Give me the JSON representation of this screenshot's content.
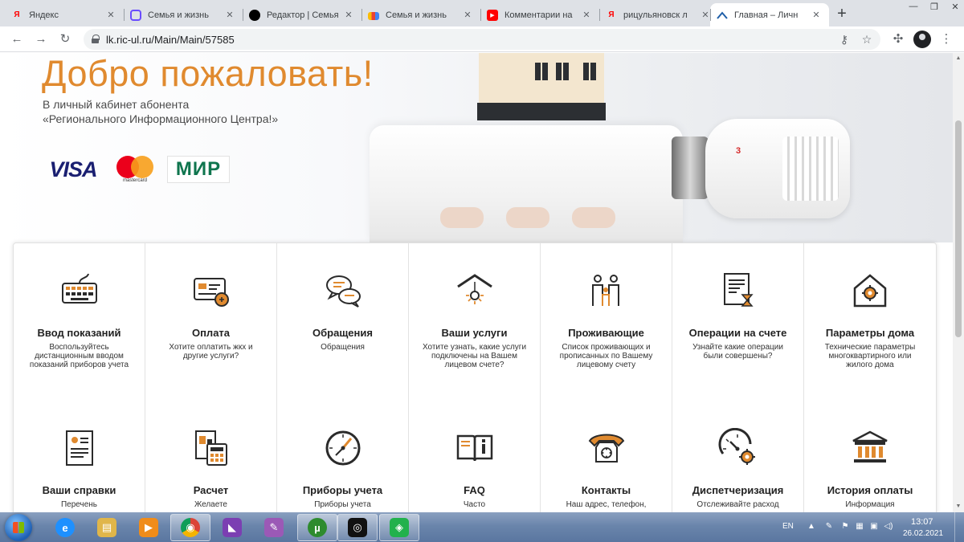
{
  "browser": {
    "tabs": [
      {
        "title": "Яндекс",
        "favicon": "yandex-icon",
        "fav_text": "Я",
        "fav_color": "#ff0000"
      },
      {
        "title": "Семья и жизнь",
        "favicon": "zen-icon",
        "fav_text": "",
        "fav_color": "#6a4cff"
      },
      {
        "title": "Редактор | Семья",
        "favicon": "editor-icon",
        "fav_text": "",
        "fav_color": "#000000"
      },
      {
        "title": "Семья и жизнь",
        "favicon": "chart-icon",
        "fav_text": "",
        "fav_color": "#fbbc05"
      },
      {
        "title": "Комментарии на",
        "favicon": "youtube-icon",
        "fav_text": "▶",
        "fav_color": "#ff0000"
      },
      {
        "title": "рицульяновск л",
        "favicon": "yandex-icon",
        "fav_text": "Я",
        "fav_color": "#ff0000"
      },
      {
        "title": "Главная – Личн",
        "favicon": "house-logo-icon",
        "fav_text": "",
        "fav_color": "#1f5fa8",
        "active": true
      }
    ],
    "new_tab": "+",
    "url": "lk.ric-ul.ru/Main/Main/57585"
  },
  "hero": {
    "title": "Добро пожаловать!",
    "subtitle_line1": "В личный кабинет абонента",
    "subtitle_line2": "«Регионального Информационного Центра!»",
    "payment": {
      "visa": "VISA",
      "mastercard": "mastercard",
      "mir": "МИР"
    }
  },
  "cards": [
    {
      "title": "Ввод показаний",
      "desc": "Воспользуйтесь дистанционным вводом показаний приборов учета",
      "icon": "keyboard-icon"
    },
    {
      "title": "Оплата",
      "desc": "Хотите оплатить жкх и другие услуги?",
      "icon": "payment-card-icon"
    },
    {
      "title": "Обращения",
      "desc": "Обращения",
      "icon": "chat-bubbles-icon"
    },
    {
      "title": "Ваши услуги",
      "desc": "Хотите узнать, какие услуги подключены на Вашем лицевом счете?",
      "icon": "house-lamp-icon"
    },
    {
      "title": "Проживающие",
      "desc": "Список проживающих и прописанных по Вашему лицевому счету",
      "icon": "family-icon"
    },
    {
      "title": "Операции на счете",
      "desc": "Узнайте какие операции были совершены?",
      "icon": "document-hourglass-icon"
    },
    {
      "title": "Параметры дома",
      "desc": "Технические параметры многоквартирного или жилого дома",
      "icon": "house-gear-icon"
    },
    {
      "title": "Ваши справки",
      "desc": "Перечень",
      "icon": "certificate-icon"
    },
    {
      "title": "Расчет",
      "desc": "Желаете",
      "icon": "calculator-icon"
    },
    {
      "title": "Приборы учета",
      "desc": "Приборы учета",
      "icon": "gauge-icon"
    },
    {
      "title": "FAQ",
      "desc": "Часто",
      "icon": "info-book-icon"
    },
    {
      "title": "Контакты",
      "desc": "Наш адрес, телефон,",
      "icon": "telephone-icon"
    },
    {
      "title": "Диспетчеризация",
      "desc": "Отслеживайте расход",
      "icon": "speedometer-gear-icon"
    },
    {
      "title": "История оплаты",
      "desc": "Информация",
      "icon": "bank-icon"
    }
  ],
  "taskbar": {
    "apps": [
      {
        "name": "internet-explorer-icon",
        "glyph": "e",
        "color": "#1e90ff"
      },
      {
        "name": "file-explorer-icon",
        "glyph": "▤",
        "color": "#e0b64a"
      },
      {
        "name": "media-player-icon",
        "glyph": "▶",
        "color": "#f08c1a"
      },
      {
        "name": "chrome-icon",
        "glyph": "◉",
        "color": "#db4437",
        "open": true
      },
      {
        "name": "visual-studio-icon",
        "glyph": "◣",
        "color": "#7b3fb2"
      },
      {
        "name": "feather-app-icon",
        "glyph": "✎",
        "color": "#9b59b6"
      },
      {
        "name": "utorrent-icon",
        "glyph": "µ",
        "color": "#2e8b2e",
        "open": true
      },
      {
        "name": "camera-app-icon",
        "glyph": "◎",
        "color": "#111111",
        "open": true
      },
      {
        "name": "green-app-icon",
        "glyph": "◈",
        "color": "#22b14c",
        "open": true
      }
    ],
    "lang": "EN",
    "time": "13:07",
    "date": "26.02.2021"
  }
}
